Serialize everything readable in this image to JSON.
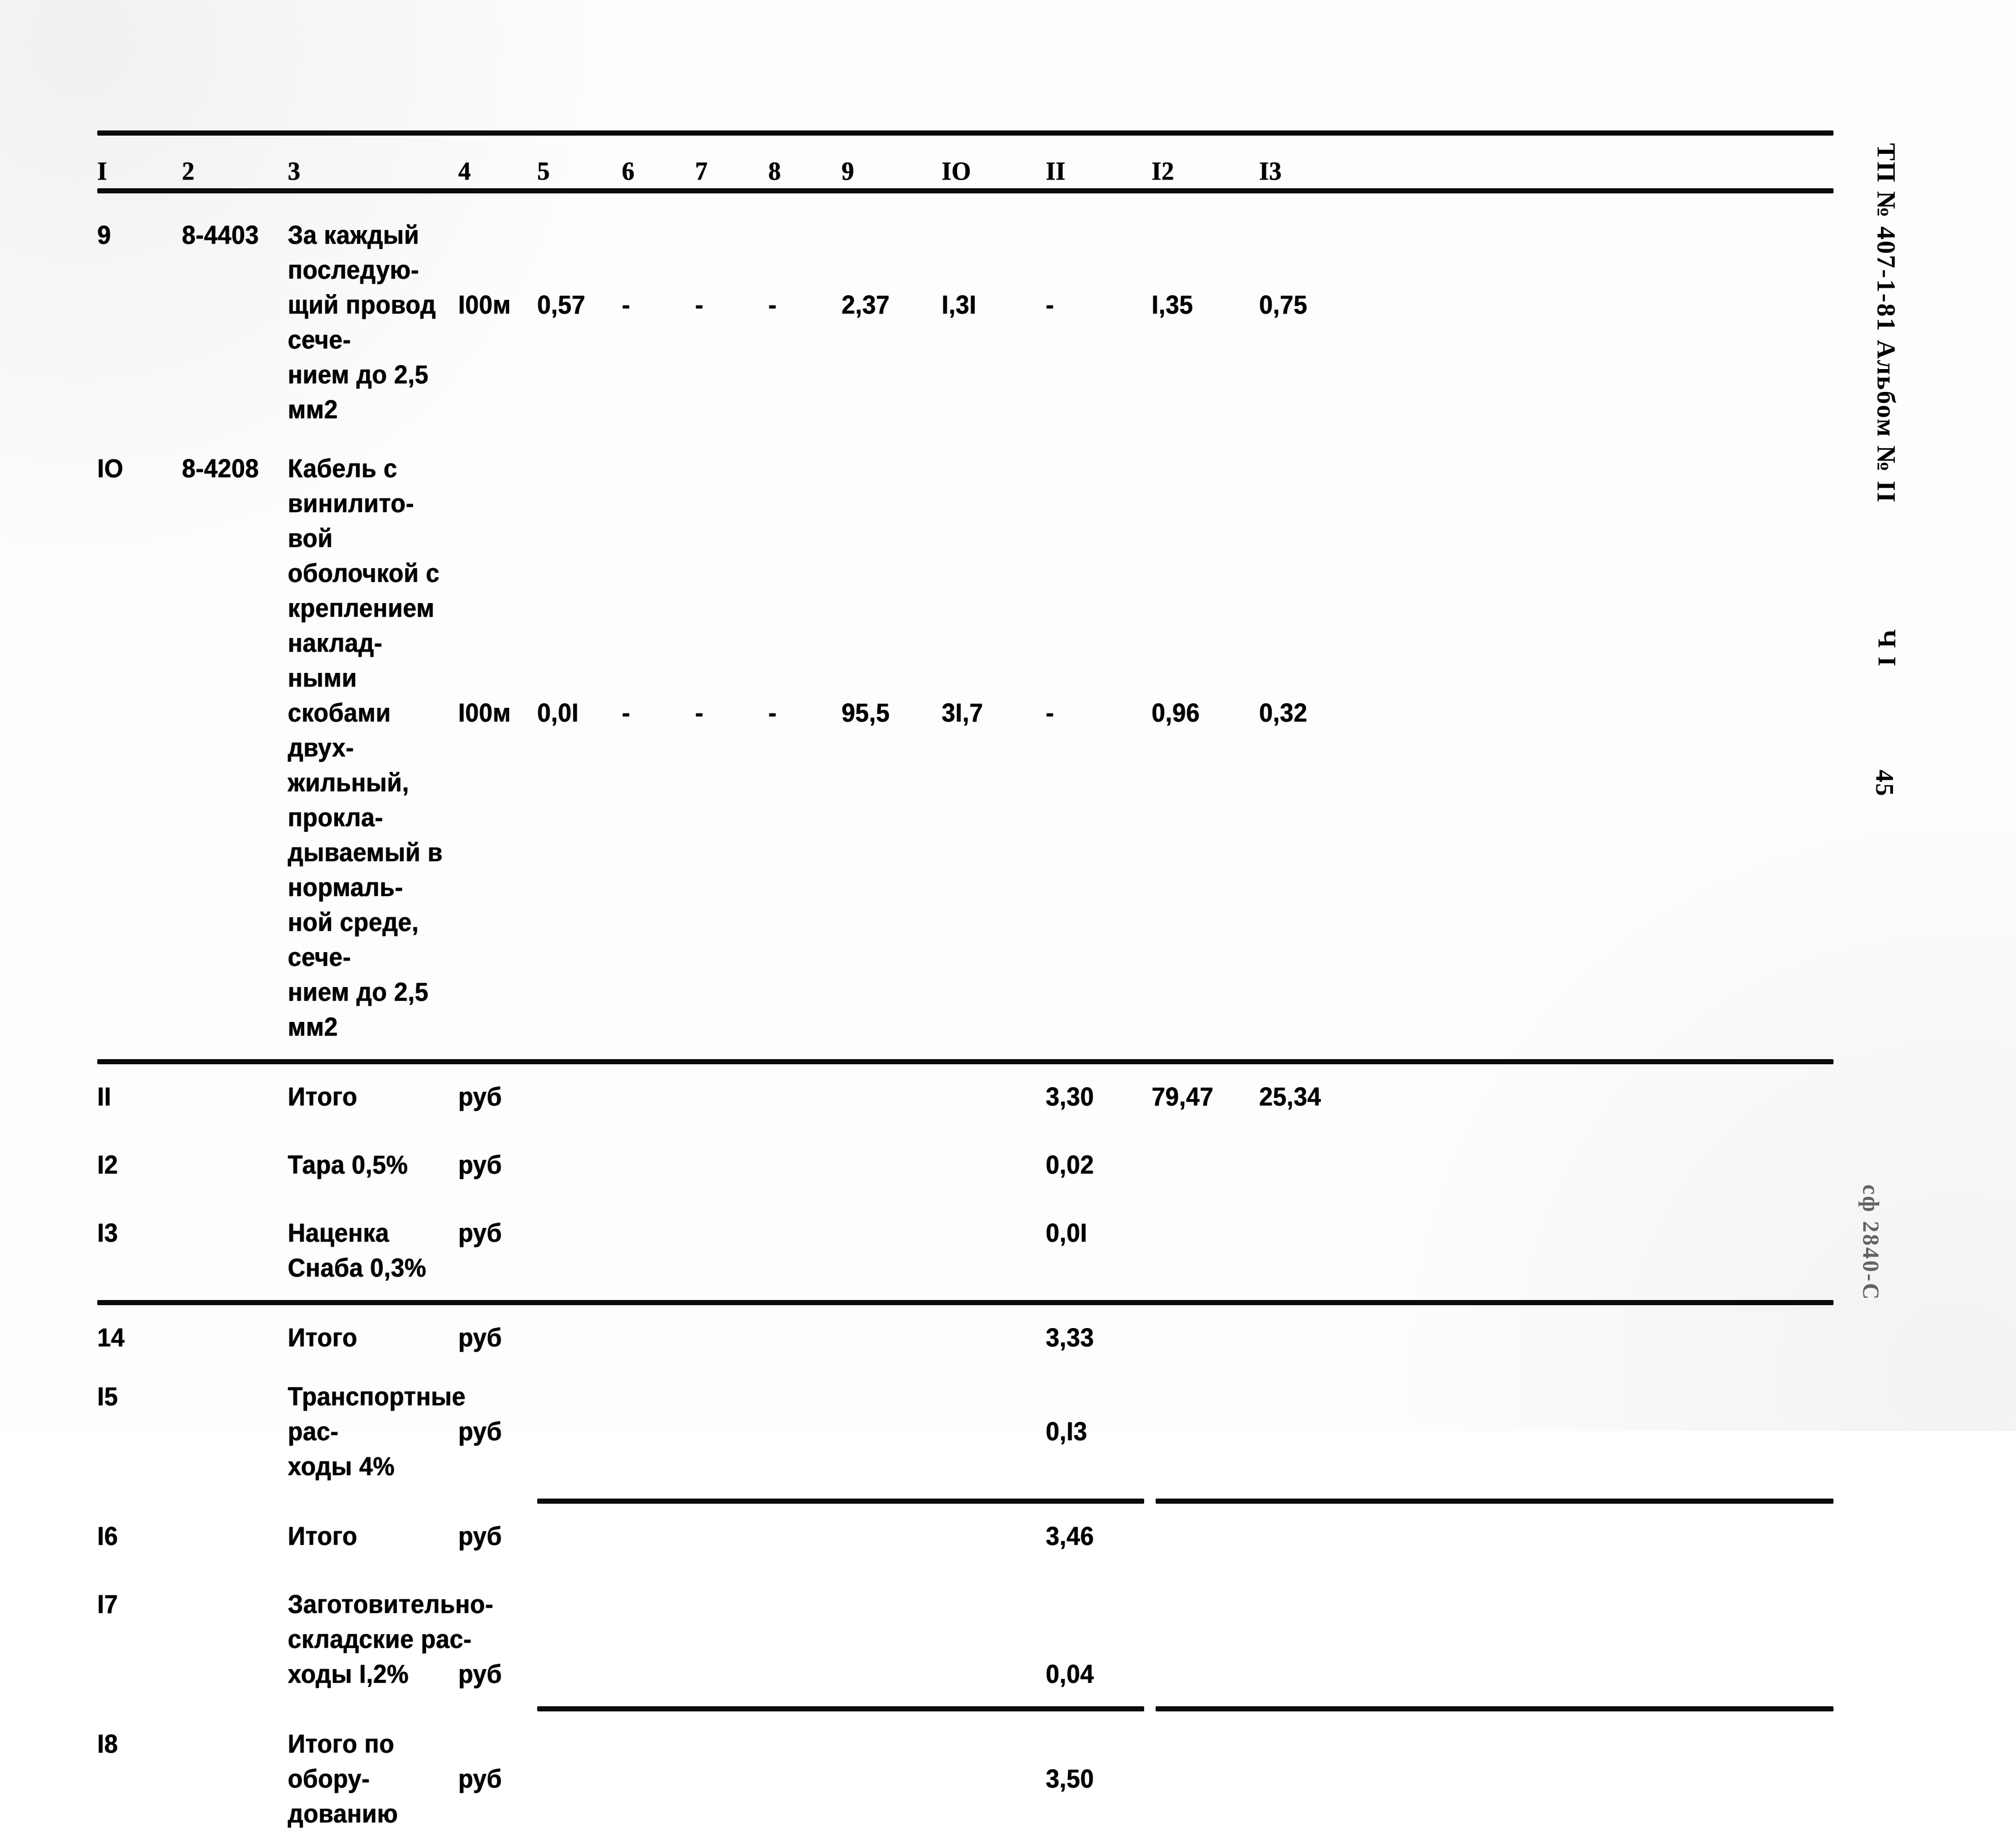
{
  "document": {
    "margin_note_main": "ТП № 407-1-81 Альбом № II",
    "margin_note_part": "Ч I",
    "margin_page_number": "45",
    "margin_stamp": "сф 2840-С"
  },
  "table": {
    "column_headers": [
      "I",
      "2",
      "3",
      "4",
      "5",
      "6",
      "7",
      "8",
      "9",
      "IO",
      "II",
      "I2",
      "I3"
    ],
    "rows": [
      {
        "no": "9",
        "code": "8-4403",
        "description": "За каждый последую-\nщий провод сече-\nнием до 2,5 мм2",
        "unit": "I00м",
        "c5": "0,57",
        "c6": "-",
        "c7": "-",
        "c8": "-",
        "c9": "2,37",
        "c10": "I,3I",
        "c11": "-",
        "c12": "I,35",
        "c13": "0,75"
      },
      {
        "no": "IO",
        "code": "8-4208",
        "description": "Кабель с винилито-\nвой оболочкой с\nкреплением наклад-\nными скобами двух-\nжильный, прокла-\nдываемый в нормаль-\nной среде, сече-\nнием до 2,5 мм2",
        "unit": "I00м",
        "c5": "0,0I",
        "c6": "-",
        "c7": "-",
        "c8": "-",
        "c9": "95,5",
        "c10": "3I,7",
        "c11": "-",
        "c12": "0,96",
        "c13": "0,32"
      },
      {
        "no": "II",
        "code": "",
        "description": "Итого",
        "unit": "руб",
        "c5": "",
        "c6": "",
        "c7": "",
        "c8": "",
        "c9": "",
        "c10": "",
        "c11": "3,30",
        "c12": "79,47",
        "c13": "25,34"
      },
      {
        "no": "I2",
        "code": "",
        "description": "Тара 0,5%",
        "unit": "руб",
        "c5": "",
        "c6": "",
        "c7": "",
        "c8": "",
        "c9": "",
        "c10": "",
        "c11": "0,02",
        "c12": "",
        "c13": ""
      },
      {
        "no": "I3",
        "code": "",
        "description": "Наценка Снаба 0,3%",
        "unit": "руб",
        "c5": "",
        "c6": "",
        "c7": "",
        "c8": "",
        "c9": "",
        "c10": "",
        "c11": "0,0I",
        "c12": "",
        "c13": ""
      },
      {
        "no": "14",
        "code": "",
        "description": "Итого",
        "unit": "руб",
        "c5": "",
        "c6": "",
        "c7": "",
        "c8": "",
        "c9": "",
        "c10": "",
        "c11": "3,33",
        "c12": "",
        "c13": ""
      },
      {
        "no": "I5",
        "code": "",
        "description": "Транспортные рас-\nходы 4%",
        "unit": "руб",
        "c5": "",
        "c6": "",
        "c7": "",
        "c8": "",
        "c9": "",
        "c10": "",
        "c11": "0,I3",
        "c12": "",
        "c13": ""
      },
      {
        "no": "I6",
        "code": "",
        "description": "Итого",
        "unit": "руб",
        "c5": "",
        "c6": "",
        "c7": "",
        "c8": "",
        "c9": "",
        "c10": "",
        "c11": "3,46",
        "c12": "",
        "c13": ""
      },
      {
        "no": "I7",
        "code": "",
        "description": "Заготовительно-\nскладские рас-\nходы I,2%",
        "unit": "руб",
        "c5": "",
        "c6": "",
        "c7": "",
        "c8": "",
        "c9": "",
        "c10": "",
        "c11": "0,04",
        "c12": "",
        "c13": ""
      },
      {
        "no": "I8",
        "code": "",
        "description": "Итого по обору-\nдованию",
        "unit": "руб",
        "c5": "",
        "c6": "",
        "c7": "",
        "c8": "",
        "c9": "",
        "c10": "",
        "c11": "3,50",
        "c12": "",
        "c13": ""
      }
    ]
  }
}
